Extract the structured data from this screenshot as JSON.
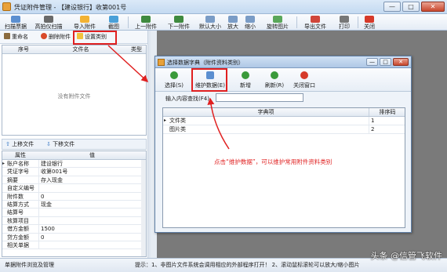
{
  "window": {
    "title": "凭证附件管理 - 【建设银行】收第001号",
    "minimize": "—",
    "maximize": "□",
    "close": "✕"
  },
  "toolbar": [
    {
      "label": "扫描票据",
      "icon": "scanner-icon"
    },
    {
      "label": "高拍仪扫描",
      "icon": "camera-icon"
    },
    {
      "label": "导入附件",
      "icon": "import-icon"
    },
    {
      "label": "截图",
      "icon": "screenshot-icon"
    },
    {
      "label": "上一附件",
      "icon": "arrow-left-icon"
    },
    {
      "label": "下一附件",
      "icon": "arrow-right-icon"
    },
    {
      "label": "默认大小",
      "icon": "fit-icon"
    },
    {
      "label": "放大",
      "icon": "zoom-in-icon"
    },
    {
      "label": "缩小",
      "icon": "zoom-out-icon"
    },
    {
      "label": "旋转图片",
      "icon": "rotate-icon"
    },
    {
      "label": "导出文件",
      "icon": "export-icon"
    },
    {
      "label": "打印",
      "icon": "print-icon"
    },
    {
      "label": "关闭",
      "icon": "close-icon"
    }
  ],
  "subbar": {
    "rename": "重命名",
    "delete": "删除附件",
    "settype": "设置类别"
  },
  "attach_grid": {
    "col_no": "序号",
    "col_name": "文件名",
    "col_type": "类型",
    "empty": "没有附件文件"
  },
  "move": {
    "up": "上移文件",
    "down": "下移文件"
  },
  "props": {
    "col_attr": "属性",
    "col_val": "值",
    "rows": [
      {
        "name": "账户名称",
        "value": "建设银行"
      },
      {
        "name": "凭证字号",
        "value": "收第001号"
      },
      {
        "name": "摘要",
        "value": "存入现金"
      },
      {
        "name": "自定义编号",
        "value": ""
      },
      {
        "name": "附件数",
        "value": "0"
      },
      {
        "name": "结算方式",
        "value": "现金"
      },
      {
        "name": "结算号",
        "value": ""
      },
      {
        "name": "核算项目",
        "value": ""
      },
      {
        "name": "借方金额",
        "value": "1500"
      },
      {
        "name": "贷方金额",
        "value": "0"
      },
      {
        "name": "相关单据",
        "value": ""
      }
    ]
  },
  "dialog": {
    "title": "选择数据字典（附件资料类别）",
    "buttons": [
      {
        "label": "选择(S)",
        "icon": "check-icon"
      },
      {
        "label": "维护数据(E)",
        "icon": "edit-icon"
      },
      {
        "label": "新增",
        "icon": "add-icon"
      },
      {
        "label": "刷新(R)",
        "icon": "refresh-icon"
      },
      {
        "label": "关闭窗口",
        "icon": "close-icon"
      }
    ],
    "search_label": "输入内容查找(F4)",
    "search_value": "",
    "col_item": "字典项",
    "col_order": "排序码",
    "rows": [
      {
        "item": "文件类",
        "order": "1"
      },
      {
        "item": "图片类",
        "order": "2"
      }
    ]
  },
  "annotation": "点击“维护数据”，可以维护常用附件资料类别",
  "status": {
    "left": "单据附件浏览及管理",
    "tip": "提示：1、非图片文件系统会调用相应的外部程序打开！ 2、滚动鼠标滚轮可以放大/缩小图片"
  },
  "watermark": "头条 @信管飞软件",
  "colors": {
    "accent_red": "#e02020",
    "workspace_gray": "#7a7a7a",
    "title_blue": "#c4daf1"
  }
}
